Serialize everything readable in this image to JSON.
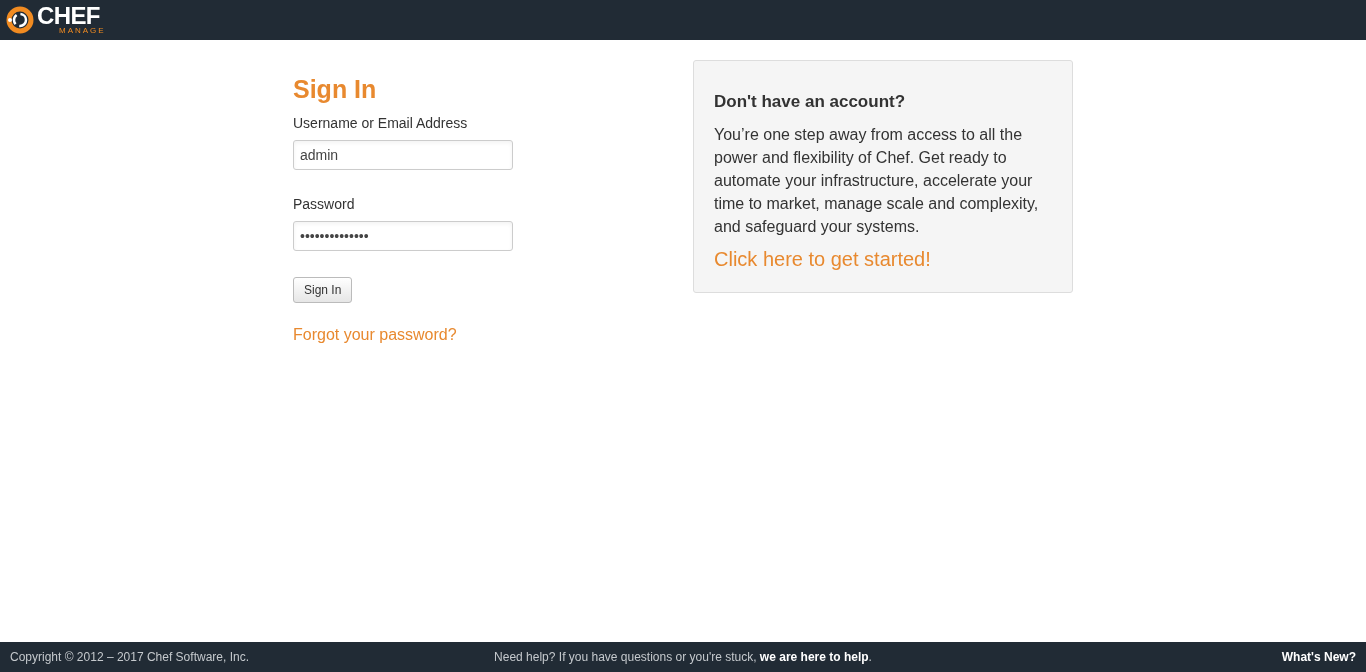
{
  "header": {
    "logo": {
      "wordmark": "CHEF",
      "subtitle": "MANAGE"
    }
  },
  "sign_in": {
    "title": "Sign In",
    "fields": [
      {
        "label": "Username or Email Address",
        "value": "admin"
      },
      {
        "label": "Password",
        "value": "••••••••••••••"
      }
    ],
    "button": "Sign In",
    "forgot_link": "Forgot your password?"
  },
  "signup_panel": {
    "heading": "Don't have an account?",
    "text": "You’re one step away from access to all the power and flexibility of Chef. Get ready to automate your infrastructure, accelerate your time to market, manage scale and complexity, and safeguard your systems.",
    "link": "Click here to get started!"
  },
  "footer": {
    "copyright": "Copyright © 2012 – 2017 Chef Software, Inc.",
    "help_text": "Need help? If you have questions or you're stuck,",
    "help_link": "we are here to help",
    "help_end": ".",
    "whats_new": "What's New?"
  }
}
